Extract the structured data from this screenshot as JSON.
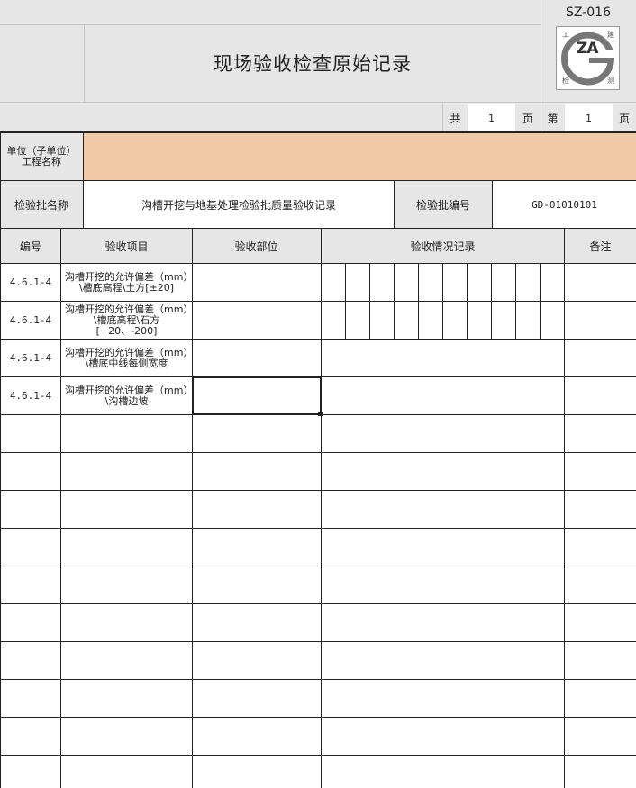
{
  "form": {
    "code": "SZ-016",
    "title": "现场验收检查原始记录",
    "logo_text": "ZA",
    "logo_corners": [
      "工",
      "建",
      "检",
      "测"
    ],
    "paging": {
      "total_label": "共",
      "total": "1",
      "page_unit": "页",
      "current_label": "第",
      "current": "1"
    }
  },
  "header": {
    "unit_label": "单位（子单位）工程名称",
    "unit_value": "",
    "batch_label": "检验批名称",
    "batch_value": "沟槽开挖与地基处理检验批质量验收记录",
    "batch_no_label": "检验批编号",
    "batch_no_value": "GD-01010101"
  },
  "table": {
    "columns": [
      "编号",
      "验收项目",
      "验收部位",
      "验收情况记录",
      "备注"
    ],
    "rows": [
      {
        "no": "4.6.1-4",
        "item": "沟槽开挖的允许偏差（mm）\\槽底高程\\土方[±20]"
      },
      {
        "no": "4.6.1-4",
        "item": "沟槽开挖的允许偏差（mm）\\槽底高程\\石方[+20、-200]"
      },
      {
        "no": "4.6.1-4",
        "item": "沟槽开挖的允许偏差（mm）\\槽底中线每侧宽度"
      },
      {
        "no": "4.6.1-4",
        "item": "沟槽开挖的允许偏差（mm）\\沟槽边坡"
      }
    ]
  },
  "colors": {
    "header_bg": "#e6e6e6",
    "unit_value_bg": "#f2c9a7"
  }
}
